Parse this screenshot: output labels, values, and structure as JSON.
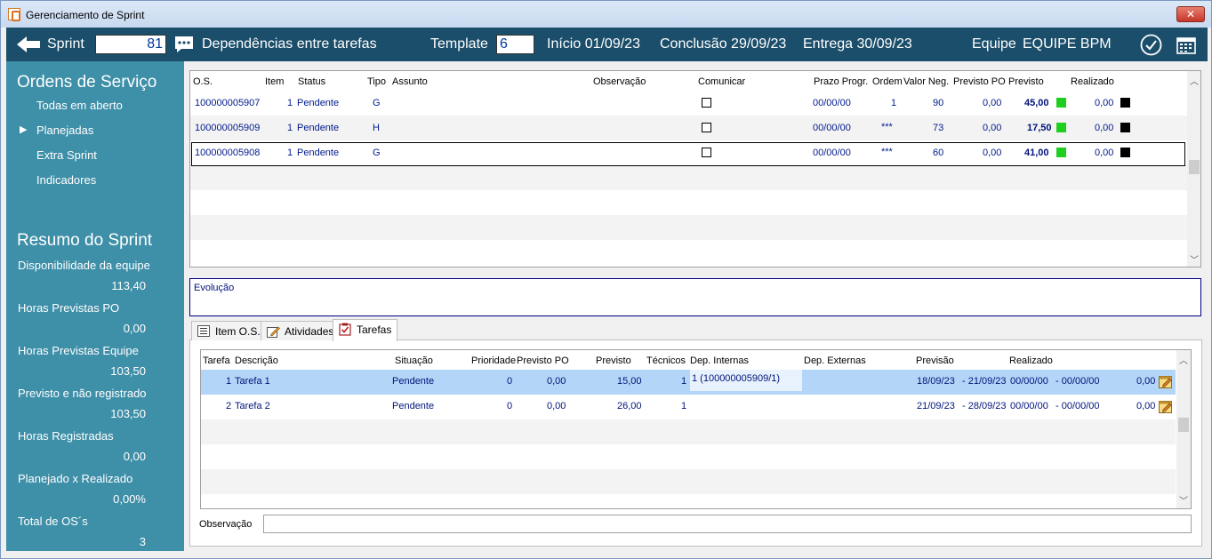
{
  "window": {
    "title": "Gerenciamento de Sprint",
    "close": "✕"
  },
  "topbar": {
    "sprint_label": "Sprint",
    "sprint_number": "81",
    "dependencias": "Dependências entre tarefas",
    "template_label": "Template",
    "template_value": "6",
    "inicio": "Início 01/09/23",
    "conclusao": "Conclusão 29/09/23",
    "entrega": "Entrega 30/09/23",
    "equipe_label": "Equipe",
    "equipe_value": "EQUIPE BPM"
  },
  "sidebar": {
    "ordens_title": "Ordens de Serviço",
    "items": [
      "Todas em aberto",
      "Planejadas",
      "Extra Sprint",
      "Indicadores"
    ],
    "selected_marker": "▶",
    "resumo_title": "Resumo do Sprint",
    "summary": [
      {
        "label": "Disponibilidade da equipe",
        "value": "113,40"
      },
      {
        "label": "Horas Previstas PO",
        "value": "0,00"
      },
      {
        "label": "Horas Previstas Equipe",
        "value": "103,50"
      },
      {
        "label": "Previsto e não registrado",
        "value": "103,50"
      },
      {
        "label": "Horas Registradas",
        "value": "0,00"
      },
      {
        "label": "Planejado x Realizado",
        "value": "0,00%"
      },
      {
        "label": "Total de OS´s",
        "value": "3"
      }
    ]
  },
  "os_grid": {
    "headers": [
      "O.S.",
      "Item",
      "Status",
      "Tipo",
      "Assunto",
      "Observação",
      "Comunicar",
      "Prazo Progr.",
      "Ordem",
      "Valor Neg.",
      "Previsto PO",
      "Previsto",
      "Realizado"
    ],
    "rows": [
      {
        "os": "100000005907",
        "item": "1",
        "status": "Pendente",
        "tipo": "G",
        "prazo": "00/00/00",
        "ordem": "1",
        "valor": "90",
        "previsto_po": "0,00",
        "previsto": "45,00",
        "realizado": "0,00"
      },
      {
        "os": "100000005909",
        "item": "1",
        "status": "Pendente",
        "tipo": "H",
        "prazo": "00/00/00",
        "ordem": "***",
        "valor": "73",
        "previsto_po": "0,00",
        "previsto": "17,50",
        "realizado": "0,00"
      },
      {
        "os": "100000005908",
        "item": "1",
        "status": "Pendente",
        "tipo": "G",
        "prazo": "00/00/00",
        "ordem": "***",
        "valor": "60",
        "previsto_po": "0,00",
        "previsto": "41,00",
        "realizado": "0,00"
      }
    ]
  },
  "evolucao": {
    "label": "Evolução"
  },
  "tabs": [
    "Item O.S.",
    "Atividades",
    "Tarefas"
  ],
  "task_grid": {
    "headers": [
      "Tarefa",
      "Descrição",
      "Situação",
      "Prioridade",
      "Previsto PO",
      "Previsto",
      "Técnicos",
      "Dep. Internas",
      "Dep. Externas",
      "Previsão",
      "Realizado"
    ],
    "rows": [
      {
        "num": "1",
        "desc": "Tarefa 1",
        "situacao": "Pendente",
        "prioridade": "0",
        "previsto_po": "0,00",
        "previsto": "15,00",
        "tecnicos": "1",
        "dep_int": "1 (100000005909/1)",
        "previsao_ini": "18/09/23",
        "previsao_fim": "- 21/09/23",
        "real_ini": "00/00/00",
        "real_fim": "- 00/00/00",
        "realizado": "0,00"
      },
      {
        "num": "2",
        "desc": "Tarefa 2",
        "situacao": "Pendente",
        "prioridade": "0",
        "previsto_po": "0,00",
        "previsto": "26,00",
        "tecnicos": "1",
        "dep_int": "",
        "previsao_ini": "21/09/23",
        "previsao_fim": "- 28/09/23",
        "real_ini": "00/00/00",
        "real_fim": "- 00/00/00",
        "realizado": "0,00"
      }
    ]
  },
  "observacao": {
    "label": "Observação",
    "value": ""
  },
  "colors": {
    "topbar": "#1b4e6a",
    "sidebar": "#3e8fa8",
    "green": "#1fcf1f",
    "selected_row": "#b3d5f7"
  }
}
